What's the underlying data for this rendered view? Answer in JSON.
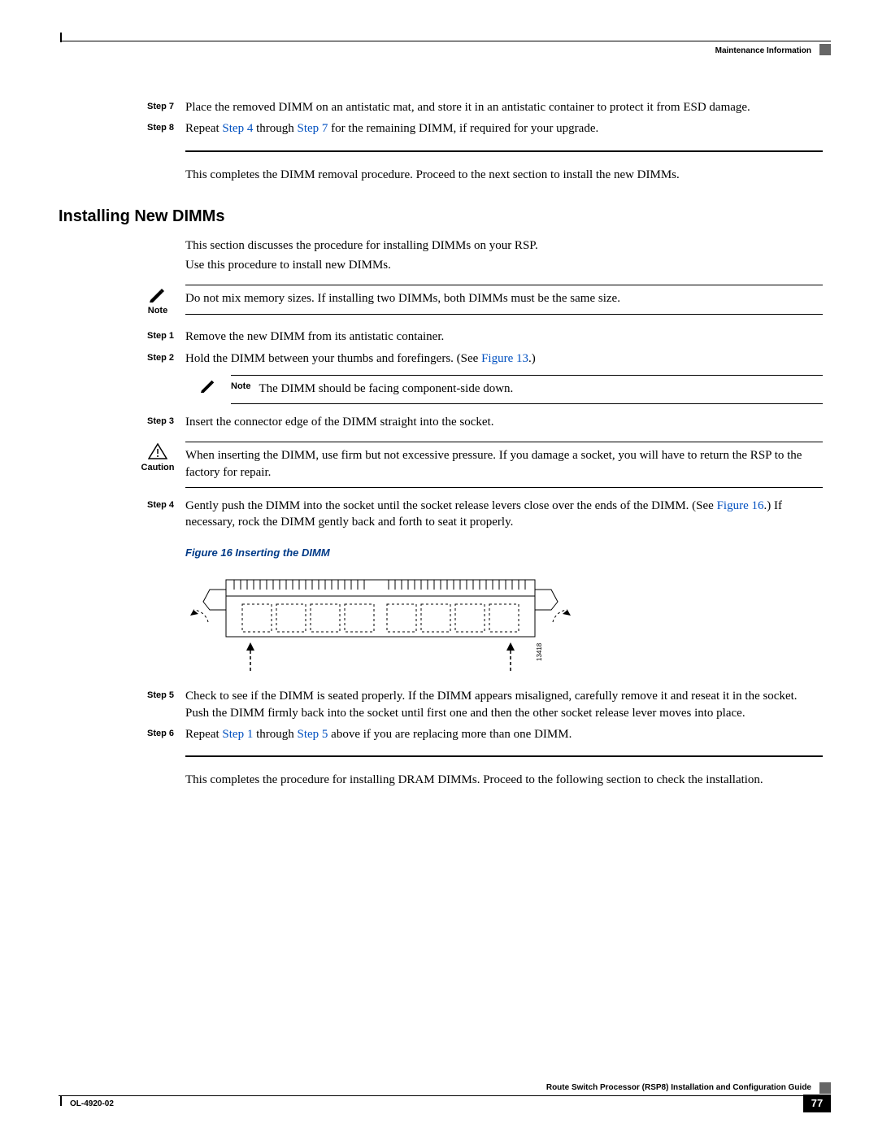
{
  "header": {
    "section": "Maintenance Information"
  },
  "removal": {
    "step7_lbl": "Step 7",
    "step7_txt": "Place the removed DIMM on an antistatic mat, and store it in an antistatic container to protect it from ESD damage.",
    "step8_lbl": "Step 8",
    "step8_a": "Repeat ",
    "step8_l1": "Step 4",
    "step8_b": " through ",
    "step8_l2": "Step 7",
    "step8_c": " for the remaining DIMM, if required for your upgrade.",
    "closing": "This completes the DIMM removal procedure. Proceed to the next section to install the new DIMMs."
  },
  "install": {
    "heading": "Installing New DIMMs",
    "intro1": "This section discusses the procedure for installing DIMMs on your RSP.",
    "intro2": "Use this procedure to install new DIMMs.",
    "note_lbl": "Note",
    "note1": "Do not mix memory sizes. If installing two DIMMs, both DIMMs must be the same size.",
    "step1_lbl": "Step 1",
    "step1": "Remove the new DIMM from its antistatic container.",
    "step2_lbl": "Step 2",
    "step2_a": "Hold the DIMM between your thumbs and forefingers. (See ",
    "step2_l": "Figure 13",
    "step2_b": ".)",
    "note2": "The DIMM should be facing component-side down.",
    "step3_lbl": "Step 3",
    "step3": "Insert the connector edge of the DIMM straight into the socket.",
    "caution_lbl": "Caution",
    "caution": "When inserting the DIMM, use firm but not excessive pressure. If you damage a socket, you will have to return the RSP to the factory for repair.",
    "step4_lbl": "Step 4",
    "step4_a": "Gently push the DIMM into the socket until the socket release levers close over the ends of the DIMM. (See ",
    "step4_l": "Figure 16",
    "step4_b": ".) If necessary, rock the DIMM gently back and forth to seat it properly.",
    "fig_cap": "Figure 16      Inserting the DIMM",
    "fig_id": "13418",
    "step5_lbl": "Step 5",
    "step5": "Check to see if the DIMM is seated properly. If the DIMM appears misaligned, carefully remove it and reseat it in the socket. Push the DIMM firmly back into the socket until first one and then the other socket release lever moves into place.",
    "step6_lbl": "Step 6",
    "step6_a": "Repeat ",
    "step6_l1": "Step 1",
    "step6_b": " through ",
    "step6_l2": "Step 5",
    "step6_c": " above if you are replacing more than one DIMM.",
    "closing": "This completes the procedure for installing DRAM DIMMs. Proceed to the following section to check the installation."
  },
  "footer": {
    "title": "Route Switch Processor (RSP8) Installation and Configuration Guide",
    "doc": "OL-4920-02",
    "page": "77"
  }
}
